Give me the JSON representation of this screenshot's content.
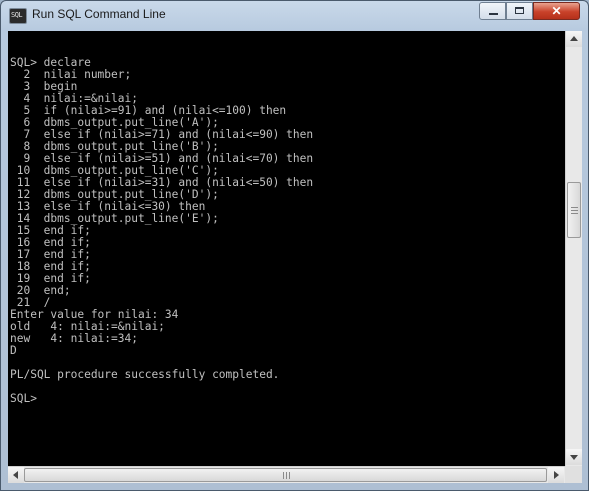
{
  "window": {
    "title": "Run SQL Command Line",
    "icon": "sql-console-icon",
    "icon_text": "SQL",
    "close_label": "✕"
  },
  "console": {
    "lines": [
      "SQL> declare",
      "  2  nilai number;",
      "  3  begin",
      "  4  nilai:=&nilai;",
      "  5  if (nilai>=91) and (nilai<=100) then",
      "  6  dbms_output.put_line('A');",
      "  7  else if (nilai>=71) and (nilai<=90) then",
      "  8  dbms_output.put_line('B');",
      "  9  else if (nilai>=51) and (nilai<=70) then",
      " 10  dbms_output.put_line('C');",
      " 11  else if (nilai>=31) and (nilai<=50) then",
      " 12  dbms_output.put_line('D');",
      " 13  else if (nilai<=30) then",
      " 14  dbms_output.put_line('E');",
      " 15  end if;",
      " 16  end if;",
      " 17  end if;",
      " 18  end if;",
      " 19  end if;",
      " 20  end;",
      " 21  /",
      "Enter value for nilai: 34",
      "old   4: nilai:=&nilai;",
      "new   4: nilai:=34;",
      "D",
      "",
      "PL/SQL procedure successfully completed.",
      "",
      "SQL>"
    ],
    "text_color": "#c0c0c0",
    "background_color": "#000000"
  },
  "colors": {
    "titlebar": "#b7cadf",
    "close_button": "#c9422a"
  }
}
